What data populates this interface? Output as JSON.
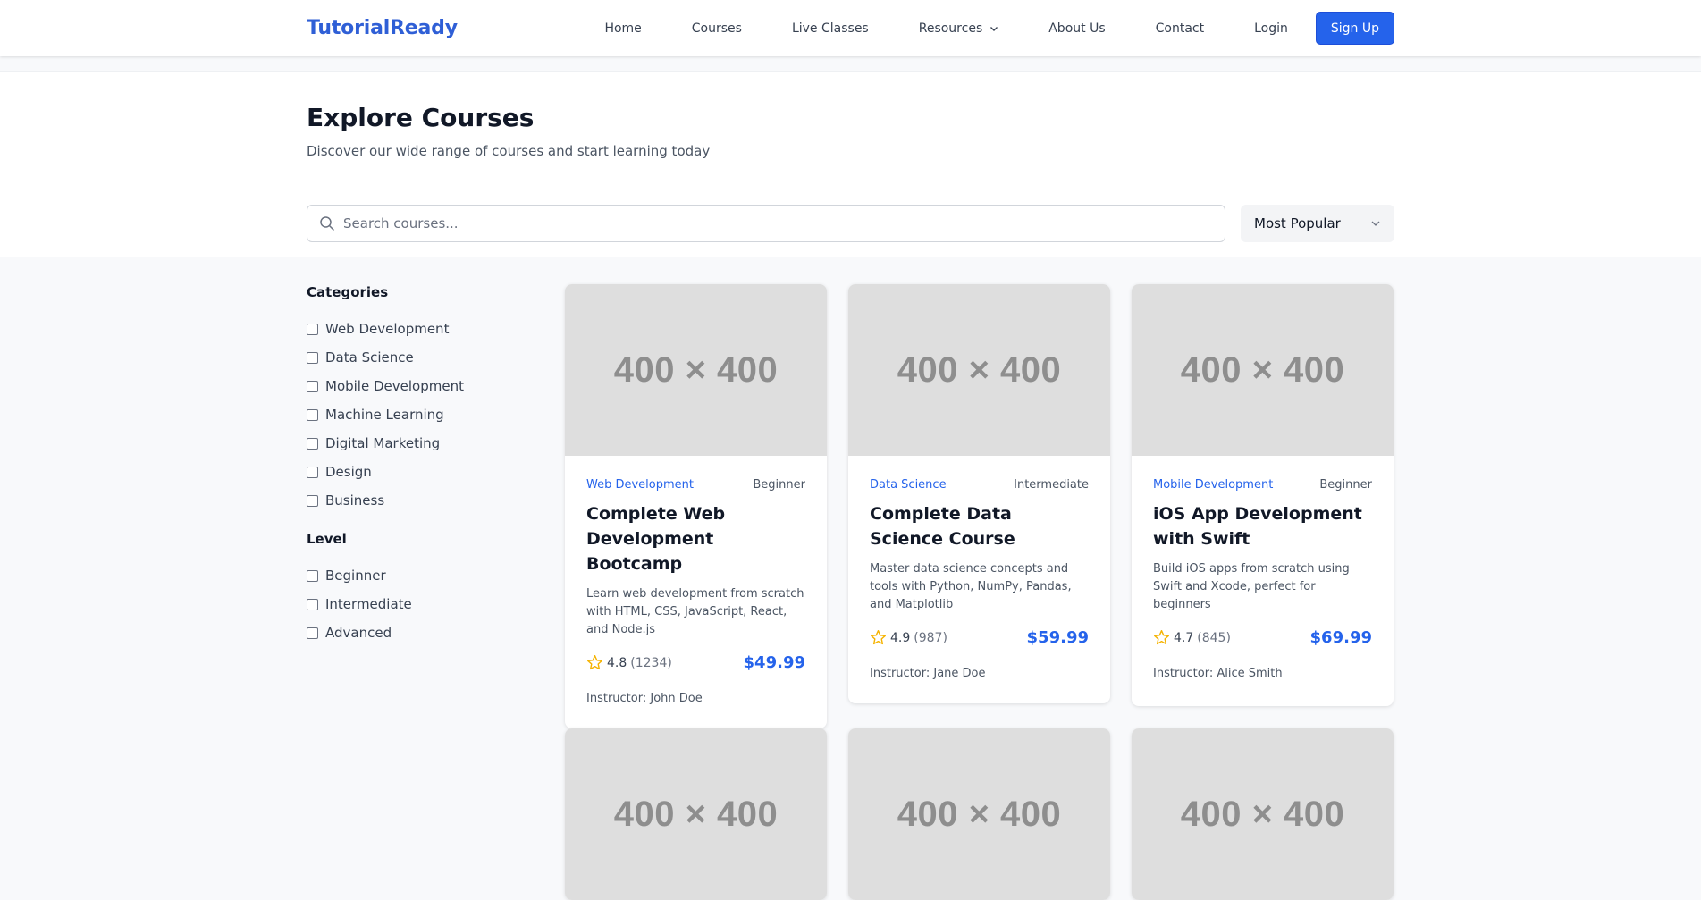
{
  "nav": {
    "brand": "TutorialReady",
    "links": [
      "Home",
      "Courses",
      "Live Classes",
      "Resources",
      "About Us",
      "Contact"
    ],
    "login": "Login",
    "signup": "Sign Up"
  },
  "header": {
    "title": "Explore Courses",
    "subtitle": "Discover our wide range of courses and start learning today",
    "search_placeholder": "Search courses...",
    "sort_selected": "Most Popular"
  },
  "filters": {
    "categories_title": "Categories",
    "categories": [
      "Web Development",
      "Data Science",
      "Mobile Development",
      "Machine Learning",
      "Digital Marketing",
      "Design",
      "Business"
    ],
    "level_title": "Level",
    "levels": [
      "Beginner",
      "Intermediate",
      "Advanced"
    ]
  },
  "placeholder_label": "400 × 400",
  "courses": [
    {
      "category": "Web Development",
      "level": "Beginner",
      "title": "Complete Web Development Bootcamp",
      "description": "Learn web development from scratch with HTML, CSS, JavaScript, React, and Node.js",
      "rating": "4.8",
      "reviews": "(1234)",
      "price": "$49.99",
      "instructor": "Instructor: John Doe"
    },
    {
      "category": "Data Science",
      "level": "Intermediate",
      "title": "Complete Data Science Course",
      "description": "Master data science concepts and tools with Python, NumPy, Pandas, and Matplotlib",
      "rating": "4.9",
      "reviews": "(987)",
      "price": "$59.99",
      "instructor": "Instructor: Jane Doe"
    },
    {
      "category": "Mobile Development",
      "level": "Beginner",
      "title": "iOS App Development with Swift",
      "description": "Build iOS apps from scratch using Swift and Xcode, perfect for beginners",
      "rating": "4.7",
      "reviews": "(845)",
      "price": "$69.99",
      "instructor": "Instructor: Alice Smith"
    }
  ],
  "colors": {
    "accent": "#2563eb",
    "star": "#f5b301"
  }
}
